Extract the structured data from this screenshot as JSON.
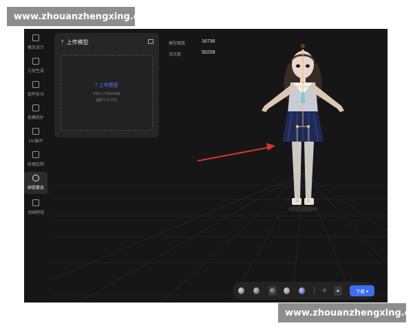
{
  "watermark": {
    "text": "www.zhouanzhengxing.com"
  },
  "sidebar": {
    "items": [
      {
        "label": "概念设计",
        "icon": "concept-icon",
        "active": false
      },
      {
        "label": "几何生成",
        "icon": "geometry-icon",
        "active": false
      },
      {
        "label": "组件拆分",
        "icon": "split-icon",
        "active": false
      },
      {
        "label": "低模拓扑",
        "icon": "topology-icon",
        "active": false
      },
      {
        "label": "UV展开",
        "icon": "uv-icon",
        "active": false
      },
      {
        "label": "纹理绘制",
        "icon": "texture-icon",
        "active": false
      },
      {
        "label": "绑骨蒙皮",
        "icon": "rig-icon",
        "active": true
      },
      {
        "label": "动画特效",
        "icon": "animation-icon",
        "active": false
      }
    ]
  },
  "upload_panel": {
    "title": "上传模型",
    "button_label": "上传模型",
    "hint_format": "FBX,小于600MB",
    "hint_faces": "面数小于10万"
  },
  "stats": {
    "faces_label": "模型面数",
    "faces_value": "16736",
    "vertices_label": "顶点数",
    "vertices_value": "50208"
  },
  "toolbar": {
    "download_label": "下载 ▾",
    "accent_color": "#3b6ef0"
  }
}
